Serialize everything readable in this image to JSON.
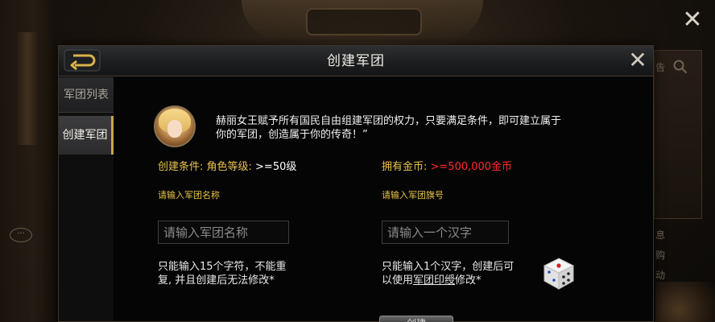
{
  "dialog": {
    "title": "创建军团",
    "back_icon": "back-arrow-icon",
    "close_symbol": "✕"
  },
  "outer_close_symbol": "✕",
  "background": {
    "right_texts": [
      "告",
      "息",
      "购",
      "动"
    ]
  },
  "sidebar": {
    "items": [
      {
        "label": "军团列表",
        "active": false
      },
      {
        "label": "创建军团",
        "active": true
      }
    ]
  },
  "intro": {
    "text_line1": "赫丽女王赋予所有国民自由组建军团的权力，只要满足条件，即可建立属于",
    "text_line2": "你的军团，创造属于你的传奇！”"
  },
  "conditions": {
    "level_label": "创建条件: 角色等级: ",
    "level_value": ">=50级",
    "gold_label": "拥有金币: ",
    "gold_value": ">=500,000金币"
  },
  "name_field": {
    "label": "请输入军团名称",
    "placeholder": "请输入军团名称",
    "value": "",
    "hint_line1": "只能输入15个字符，不能重",
    "hint_line2": "复, 并且创建后无法修改*"
  },
  "flag_field": {
    "label": "请输入军团旗号",
    "placeholder": "请输入一个汉字",
    "value": "",
    "hint_line1": "只能输入1个汉字，创建后可",
    "hint_line2_prefix": "以使用",
    "hint_line2_link": "军团印绶",
    "hint_line2_suffix": "修改*"
  },
  "create_button": {
    "label": "创建"
  },
  "colors": {
    "gold_text": "#e8c24a",
    "red_text": "#ff2a2a",
    "active_tab_accent": "#c9a64e"
  }
}
